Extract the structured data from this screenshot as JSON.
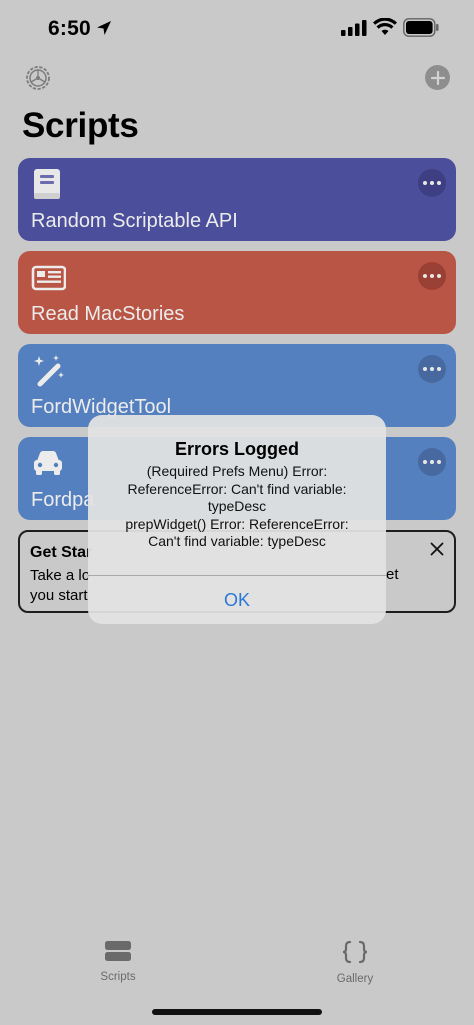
{
  "status_bar": {
    "time": "6:50"
  },
  "header": {
    "title": "Scripts"
  },
  "scripts": [
    {
      "name": "Random Scriptable API",
      "icon": "book-icon",
      "color": "#4b4e9a",
      "more_color": "#3d3f82"
    },
    {
      "name": "Read MacStories",
      "icon": "newspaper-icon",
      "color": "#b85545",
      "more_color": "#9a3f33"
    },
    {
      "name": "FordWidgetTool",
      "icon": "magic-wand-icon",
      "color": "#5480bf",
      "more_color": "#4769a0"
    },
    {
      "name": "Fordpa",
      "icon": "car-icon",
      "color": "#5480bf",
      "more_color": "#4769a0"
    }
  ],
  "tip": {
    "title": "Get Star",
    "body_left": "Take a lo",
    "body_right": "et",
    "body_line2": "you start"
  },
  "alert": {
    "title": "Errors Logged",
    "message": "(Required Prefs Menu) Error: ReferenceError: Can't find variable: typeDesc prepWidget() Error: ReferenceError: Can't find variable: typeDesc",
    "line1": "(Required Prefs Menu) Error:",
    "line2": "ReferenceError: Can't find variable:",
    "line3": "typeDesc",
    "line4": "prepWidget() Error: ReferenceError:",
    "line5": "Can't find variable: typeDesc",
    "ok_label": "OK"
  },
  "tab_bar": {
    "tabs": [
      {
        "label": "Scripts",
        "icon": "scripts-stack-icon"
      },
      {
        "label": "Gallery",
        "icon": "curly-braces-icon"
      }
    ]
  },
  "colors": {
    "background": "#c9c9c9",
    "accent_blue": "#2a78d6"
  }
}
